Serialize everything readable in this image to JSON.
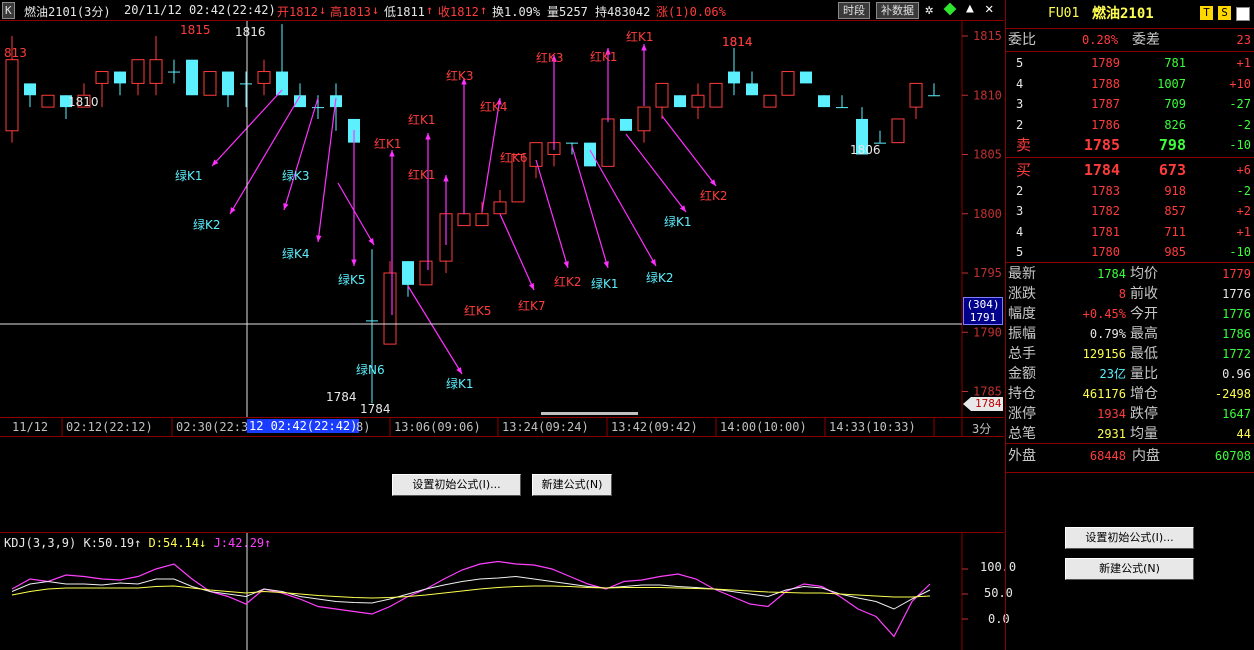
{
  "titlebar": {
    "symbol_btn": "K",
    "name": "燃油2101(3分)",
    "datetime": "20/11/12 02:42(22:42)",
    "open": "开1812",
    "open_arrow": "↓",
    "high": "高1813",
    "high_arrow": "↓",
    "low": "低1811",
    "low_arrow": "↑",
    "close": "收1812",
    "close_arrow": "↑",
    "turnover": "换1.09%",
    "volume": "量5257",
    "position": "持483042",
    "change": "涨(1)0.06%",
    "btn_shiduan": "时段",
    "btn_bushuju": "补数据"
  },
  "main": {
    "price_axis": [
      "1815",
      "1810",
      "1805",
      "1800",
      "1795",
      "1790",
      "1785"
    ],
    "cursor_label_top": "(304)",
    "cursor_label_price": "1791",
    "last_price_tag": "1784",
    "labels": [
      {
        "text": "813",
        "c": "red"
      },
      {
        "text": "1815",
        "c": "red"
      },
      {
        "text": "1816",
        "c": "wht"
      },
      {
        "text": "1810",
        "c": "wht"
      },
      {
        "text": "1814",
        "c": "red"
      },
      {
        "text": "1806",
        "c": "wht"
      },
      {
        "text": "1784",
        "c": "wht"
      },
      {
        "text": "1784",
        "c": "wht"
      },
      {
        "text": "绿K1",
        "c": "cyan"
      },
      {
        "text": "绿K2",
        "c": "cyan"
      },
      {
        "text": "绿K3",
        "c": "cyan"
      },
      {
        "text": "绿K4",
        "c": "cyan"
      },
      {
        "text": "绿K5",
        "c": "cyan"
      },
      {
        "text": "绿N6",
        "c": "cyan"
      },
      {
        "text": "绿K1",
        "c": "cyan"
      },
      {
        "text": "绿K1",
        "c": "cyan"
      },
      {
        "text": "绿K2",
        "c": "cyan"
      },
      {
        "text": "绿K1",
        "c": "cyan"
      },
      {
        "text": "红K1",
        "c": "red"
      },
      {
        "text": "红K1",
        "c": "red"
      },
      {
        "text": "红K1",
        "c": "red"
      },
      {
        "text": "红K3",
        "c": "red"
      },
      {
        "text": "红K4",
        "c": "red"
      },
      {
        "text": "红K6",
        "c": "red"
      },
      {
        "text": "红K3",
        "c": "red"
      },
      {
        "text": "红K1",
        "c": "red"
      },
      {
        "text": "红K1",
        "c": "red"
      },
      {
        "text": "1814",
        "c": "red"
      },
      {
        "text": "红K2",
        "c": "red"
      },
      {
        "text": "红K5",
        "c": "red"
      },
      {
        "text": "红K7",
        "c": "red"
      },
      {
        "text": "红K2",
        "c": "red"
      }
    ]
  },
  "time_axis": {
    "labels": [
      "11/12",
      "02:12(22:12)",
      "02:30(22:3",
      "12 02:42(22:42)",
      "8)",
      "13:06(09:06)",
      "13:24(09:24)",
      "13:42(09:42)",
      "14:00(10:00)",
      "14:33(10:33)"
    ],
    "period": "3分"
  },
  "mid_panel": {
    "btn_init": "设置初始公式(I)...",
    "btn_new": "新建公式(N)"
  },
  "kdj": {
    "name": "KDJ(3,3,9)",
    "k": "K:50.19",
    "k_arrow": "↑",
    "d": "D:54.14",
    "d_arrow": "↓",
    "j": "J:42.29",
    "j_arrow": "↑",
    "axis": [
      "100.0",
      "50.0",
      "0.0"
    ]
  },
  "right": {
    "code": "FU01",
    "name": "燃油2101",
    "icon_t": "T",
    "icon_s": "S",
    "weibi_label": "委比",
    "weibi_value": "0.28%",
    "weicha_label": "委差",
    "weicha_value": "23",
    "asks": [
      {
        "lv": "5",
        "price": "1789",
        "vol": "781",
        "chg": "+1"
      },
      {
        "lv": "4",
        "price": "1788",
        "vol": "1007",
        "chg": "+10"
      },
      {
        "lv": "3",
        "price": "1787",
        "vol": "709",
        "chg": "-27"
      },
      {
        "lv": "2",
        "price": "1786",
        "vol": "826",
        "chg": "-2"
      },
      {
        "lv": "卖",
        "price": "1785",
        "vol": "798",
        "chg": "-10"
      }
    ],
    "bids": [
      {
        "lv": "买",
        "price": "1784",
        "vol": "673",
        "chg": "+6"
      },
      {
        "lv": "2",
        "price": "1783",
        "vol": "918",
        "chg": "-2"
      },
      {
        "lv": "3",
        "price": "1782",
        "vol": "857",
        "chg": "+2"
      },
      {
        "lv": "4",
        "price": "1781",
        "vol": "711",
        "chg": "+1"
      },
      {
        "lv": "5",
        "price": "1780",
        "vol": "985",
        "chg": "-10"
      }
    ],
    "stats": [
      {
        "l1": "最新",
        "v1": "1784",
        "c1": "grn",
        "l2": "均价",
        "v2": "1779",
        "c2": "red"
      },
      {
        "l1": "涨跌",
        "v1": "8",
        "c1": "red",
        "l2": "前收",
        "v2": "1776",
        "c2": "wht"
      },
      {
        "l1": "幅度",
        "v1": "+0.45%",
        "c1": "red",
        "l2": "今开",
        "v2": "1776",
        "c2": "grn"
      },
      {
        "l1": "振幅",
        "v1": "0.79%",
        "c1": "wht",
        "l2": "最高",
        "v2": "1786",
        "c2": "grn"
      },
      {
        "l1": "总手",
        "v1": "129156",
        "c1": "yel",
        "l2": "最低",
        "v2": "1772",
        "c2": "grn"
      },
      {
        "l1": "金额",
        "v1": "23亿",
        "c1": "cyan",
        "l2": "量比",
        "v2": "0.96",
        "c2": "wht"
      },
      {
        "l1": "持仓",
        "v1": "461176",
        "c1": "yel",
        "l2": "增仓",
        "v2": "-2498",
        "c2": "yel"
      },
      {
        "l1": "涨停",
        "v1": "1934",
        "c1": "red",
        "l2": "跌停",
        "v2": "1647",
        "c2": "grn"
      },
      {
        "l1": "总笔",
        "v1": "2931",
        "c1": "yel",
        "l2": "均量",
        "v2": "44",
        "c2": "yel"
      }
    ],
    "outer_label": "外盘",
    "outer_value": "68448",
    "inner_label": "内盘",
    "inner_value": "60708",
    "btn_init": "设置初始公式(I)...",
    "btn_new": "新建公式(N)"
  }
}
